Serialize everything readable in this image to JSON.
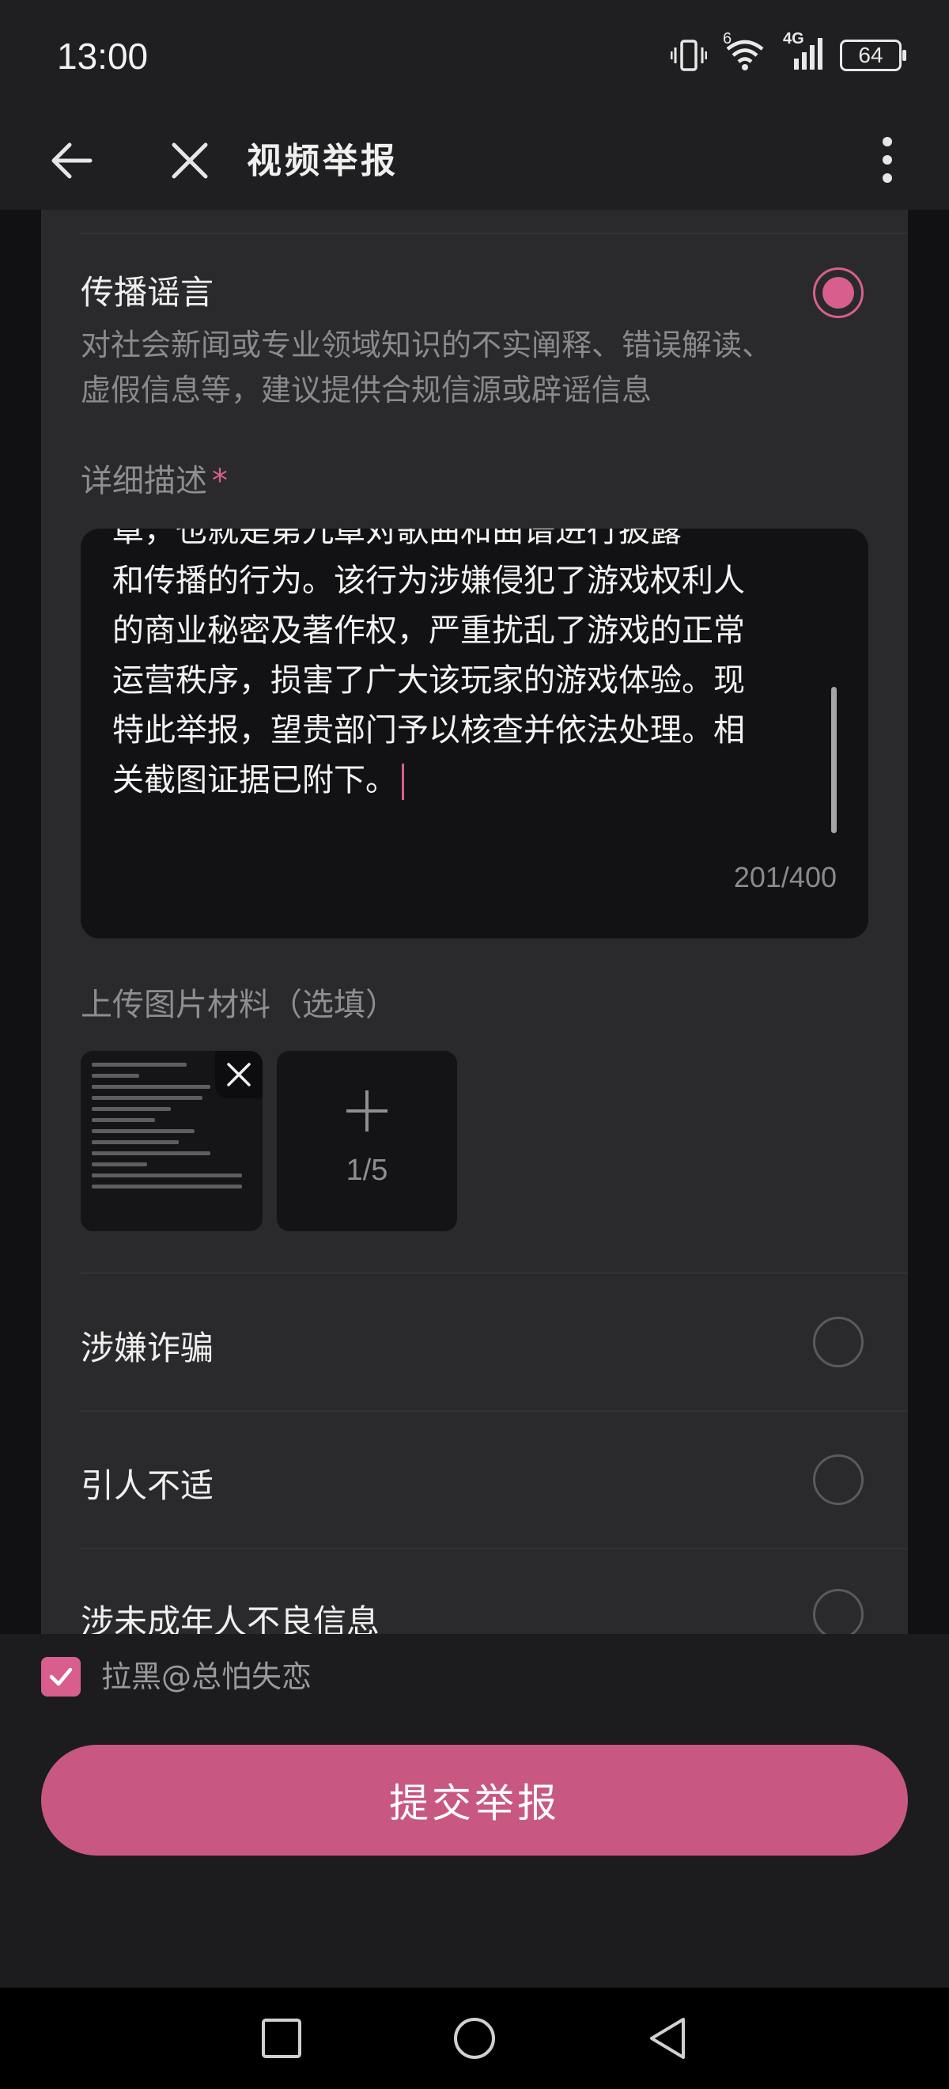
{
  "status_bar": {
    "time": "13:00",
    "network": "4G",
    "wifi_badge": "6",
    "battery": "64"
  },
  "header": {
    "title": "视频举报",
    "back_icon": "arrow-left-icon",
    "close_icon": "close-icon",
    "more_icon": "more-vertical-icon"
  },
  "options": [
    {
      "title": "传播谣言",
      "description": "对社会新闻或专业领域知识的不实阐释、错误解读、虚假信息等，建议提供合规信源或辟谣信息",
      "selected": true
    },
    {
      "title": "涉嫌诈骗",
      "selected": false
    },
    {
      "title": "引人不适",
      "selected": false
    },
    {
      "title": "涉未成年人不良信息",
      "selected": false
    }
  ],
  "detail": {
    "label": "详细描述",
    "required_mark": "*",
    "lines": [
      "章，也就是第九章对歌曲和曲谱进行披露",
      "和传播的行为。该行为涉嫌侵犯了游戏权利人",
      "的商业秘密及著作权，严重扰乱了游戏的正常",
      "运营秩序，损害了广大该玩家的游戏体验。现",
      "特此举报，望贵部门予以核查并依法处理。相",
      "关截图证据已附下。"
    ],
    "counter": "201/400"
  },
  "upload": {
    "label": "上传图片材料（选填）",
    "count": "1/5"
  },
  "block_user": {
    "label": "拉黑@总怕失恋",
    "checked": true
  },
  "submit_label": "提交举报",
  "colors": {
    "accent": "#d85f8d",
    "submit": "#c85882",
    "background": "#1c1c1e",
    "card": "#2a2a2c"
  }
}
